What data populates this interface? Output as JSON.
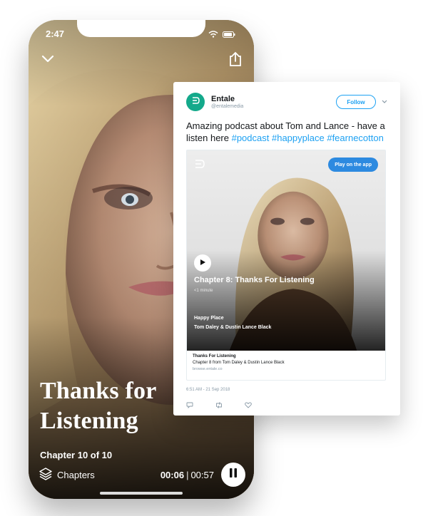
{
  "phone": {
    "status_time": "2:47",
    "title_line1": "Thanks for",
    "title_line2": "Listening",
    "chapter_count": "Chapter 10 of 10",
    "chapters_label": "Chapters",
    "elapsed": "00:06",
    "separator": "|",
    "total": "00:57"
  },
  "tweet": {
    "name": "Entale",
    "handle": "@entalemedia",
    "follow_label": "Follow",
    "text_plain": "Amazing podcast about Tom and Lance - have a listen here ",
    "hashtags": [
      "#podcast",
      "#happyplace",
      "#fearnecotton"
    ],
    "media": {
      "play_app_label": "Play on the app",
      "chapter_title": "Chapter 8: Thanks For Listening",
      "duration": "<1 minute",
      "show_name": "Happy Place",
      "hosts": "Tom Daley & Dustin Lance Black"
    },
    "link_card": {
      "title": "Thanks For Listening",
      "description": "Chapter 8 from Tom Daley & Dustin Lance Black",
      "domain": "browse.entale.co"
    },
    "timestamp": "6:51 AM - 21 Sep 2018"
  },
  "colors": {
    "brand_green": "#14a98b",
    "twitter_blue": "#1da1f2",
    "play_app_blue": "#2d8ae0"
  },
  "icons": [
    "chevron-down-icon",
    "share-icon",
    "wifi-icon",
    "battery-icon",
    "layers-icon",
    "pause-icon",
    "play-icon",
    "entale-logo-icon",
    "reply-icon",
    "retweet-icon",
    "like-icon",
    "caret-down-icon"
  ]
}
